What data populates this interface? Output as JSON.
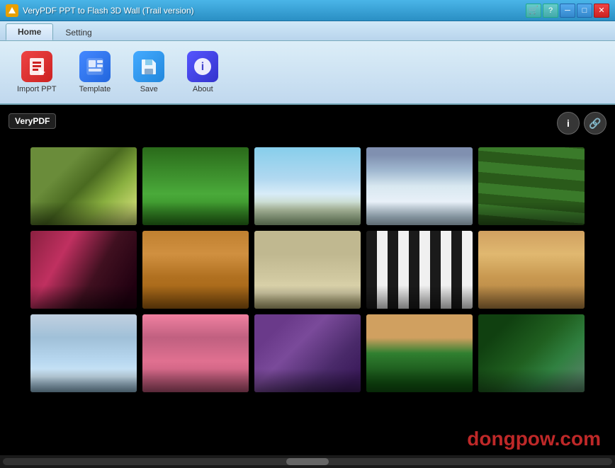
{
  "titleBar": {
    "title": "VeryPDF PPT to Flash 3D Wall (Trail version)",
    "icon": "V"
  },
  "tabs": [
    {
      "id": "home",
      "label": "Home",
      "active": true
    },
    {
      "id": "setting",
      "label": "Setting",
      "active": false
    }
  ],
  "toolbar": {
    "buttons": [
      {
        "id": "import-ppt",
        "label": "Import PPT",
        "iconType": "import"
      },
      {
        "id": "template",
        "label": "Template",
        "iconType": "template"
      },
      {
        "id": "save",
        "label": "Save",
        "iconType": "save"
      },
      {
        "id": "about",
        "label": "About",
        "iconType": "about"
      }
    ]
  },
  "mainArea": {
    "logo": "VeryPDF",
    "infoButtonLabel": "i",
    "linkButtonLabel": "🔗",
    "watermark": "dongpow.com",
    "images": [
      {
        "id": 1,
        "cssClass": "img-1",
        "alt": "Green field landscape"
      },
      {
        "id": 2,
        "cssClass": "img-2",
        "alt": "Rolling green hills"
      },
      {
        "id": 3,
        "cssClass": "img-3",
        "alt": "Snowy bare trees"
      },
      {
        "id": 4,
        "cssClass": "img-4",
        "alt": "Salt flat landscape"
      },
      {
        "id": 5,
        "cssClass": "img-5",
        "alt": "Green striped field"
      },
      {
        "id": 6,
        "cssClass": "img-6",
        "alt": "Purple mountain river"
      },
      {
        "id": 7,
        "cssClass": "img-7",
        "alt": "Mystical forest"
      },
      {
        "id": 8,
        "cssClass": "img-8",
        "alt": "Foggy water scene"
      },
      {
        "id": 9,
        "cssClass": "img-9",
        "alt": "Zebra pattern field"
      },
      {
        "id": 10,
        "cssClass": "img-10",
        "alt": "Hot air balloons sunset"
      },
      {
        "id": 11,
        "cssClass": "img-11",
        "alt": "Misty bluebell forest"
      },
      {
        "id": 12,
        "cssClass": "img-12",
        "alt": "Sunset water reflection"
      },
      {
        "id": 13,
        "cssClass": "img-13",
        "alt": "Purple flower tunnel"
      },
      {
        "id": 14,
        "cssClass": "img-14",
        "alt": "Red poppy field"
      },
      {
        "id": 15,
        "cssClass": "img-15",
        "alt": "Green mossy forest"
      }
    ]
  },
  "scrollbar": {
    "thumbPosition": "center"
  }
}
